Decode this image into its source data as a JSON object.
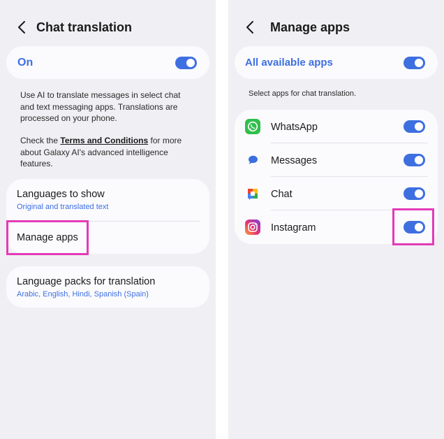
{
  "left": {
    "title": "Chat translation",
    "toggle_label": "On",
    "toggle_on": true,
    "description_1": "Use AI to translate messages in select chat and text messaging apps. Translations are processed on your phone.",
    "description_2_pre": "Check the ",
    "description_2_link": "Terms and Conditions",
    "description_2_post": " for more about Galaxy AI's advanced intelligence features.",
    "languages_title": "Languages to show",
    "languages_sub": "Original and translated text",
    "manage_apps": "Manage apps",
    "packs_title": "Language packs for translation",
    "packs_sub": "Arabic, English, Hindi, Spanish (Spain)"
  },
  "right": {
    "title": "Manage apps",
    "all_apps_label": "All available apps",
    "all_apps_on": true,
    "hint": "Select apps for chat translation.",
    "apps": [
      {
        "name": "WhatsApp",
        "icon": "whatsapp-icon",
        "on": true
      },
      {
        "name": "Messages",
        "icon": "messages-icon",
        "on": true
      },
      {
        "name": "Chat",
        "icon": "google-chat-icon",
        "on": true
      },
      {
        "name": "Instagram",
        "icon": "instagram-icon",
        "on": true
      }
    ]
  },
  "colors": {
    "accent": "#3e6fe0",
    "highlight": "#e43ab8",
    "background": "#f0f0f4",
    "card": "#fbfbfe"
  }
}
